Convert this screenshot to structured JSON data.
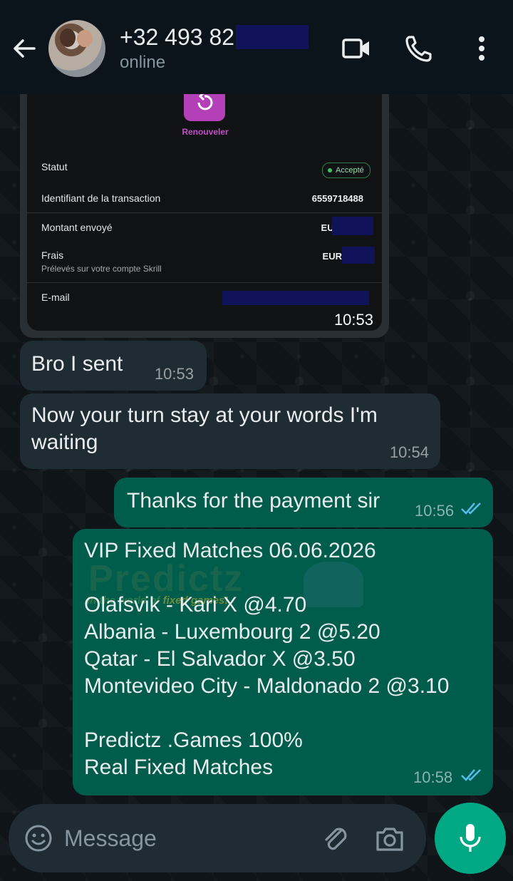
{
  "header": {
    "contact_name": "+32 493 82",
    "status": "online"
  },
  "screenshot": {
    "renew_label": "Renouveler",
    "status_label": "Statut",
    "status_badge": "Accepté",
    "transaction_label": "Identifiant de la transaction",
    "transaction_id": "6559718488",
    "amount_label": "Montant envoyé",
    "amount_currency": "EUR",
    "fees_label": "Frais",
    "fees_sub": "Prélevés sur votre compte Skrill",
    "fees_currency": "EUR",
    "email_label": "E-mail",
    "time": "10:53"
  },
  "messages": [
    {
      "text": "Bro I sent",
      "time": "10:53",
      "direction": "in"
    },
    {
      "text": "Now your turn stay at your words I'm",
      "text2": "waiting",
      "time": "10:54",
      "direction": "in"
    },
    {
      "text": "Thanks for the payment sir",
      "time": "10:56",
      "direction": "out",
      "status": "read"
    }
  ],
  "vip": {
    "watermark_title": "Predictz",
    "watermark_sub_a": "In the world of ",
    "watermark_sub_b": "fixed games!",
    "lines": [
      "VIP Fixed Matches 06.06.2026",
      "Olafsvik - Kari  X  @4.70",
      "Albania - Luxembourg  2  @5.20",
      "Qatar - El Salvador  X  @3.50",
      "Montevideo City - Maldonado  2  @3.10",
      "Predictz .Games 100%",
      "Real Fixed Matches"
    ],
    "time": "10:58",
    "status": "read"
  },
  "input": {
    "placeholder": "Message"
  },
  "colors": {
    "header_bg": "#0b141a",
    "incoming_bubble": "#202c33",
    "outgoing_bubble": "#005c4b",
    "accent": "#00a884",
    "read_ticks": "#53bdeb"
  },
  "icons": {
    "back": "arrow-left-icon",
    "video": "video-camera-icon",
    "call": "phone-icon",
    "menu": "more-vertical-icon",
    "emoji": "emoji-icon",
    "attach": "paperclip-icon",
    "camera": "camera-icon",
    "mic": "microphone-icon"
  }
}
